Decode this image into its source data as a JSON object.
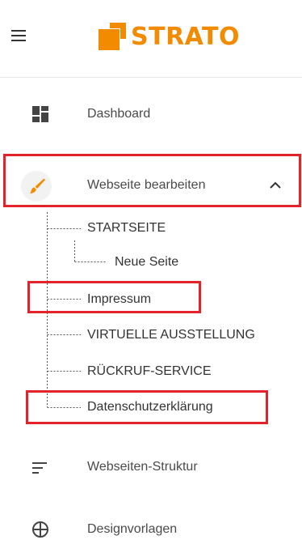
{
  "header": {
    "logo_text": "STRATO",
    "brand_color": "#f38b00"
  },
  "nav": {
    "dashboard": {
      "label": "Dashboard",
      "icon": "dashboard-icon"
    },
    "edit_website": {
      "label": "Webseite bearbeiten",
      "icon": "brush-icon",
      "expanded": true
    },
    "subitems": {
      "startseite": "STARTSEITE",
      "neue_seite": "Neue Seite",
      "impressum": "Impressum",
      "virtuelle": "VIRTUELLE AUSSTELLUNG",
      "rueckruf": "RÜCKRUF-SERVICE",
      "datenschutz": "Datenschutzerklärung"
    },
    "structure": {
      "label": "Webseiten-Struktur",
      "icon": "structure-icon"
    },
    "designs": {
      "label": "Designvorlagen",
      "icon": "globe-icon"
    }
  },
  "highlight_color": "#e4222c"
}
